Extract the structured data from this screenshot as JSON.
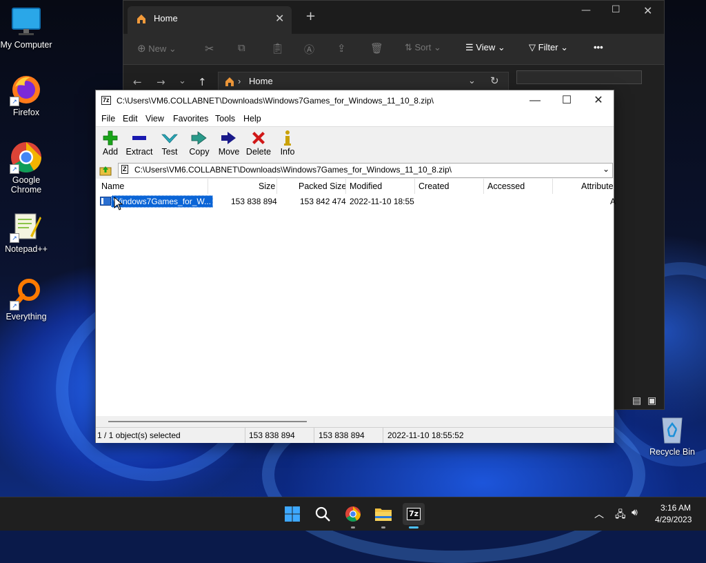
{
  "desktop": {
    "icons": [
      {
        "label": "My Computer"
      },
      {
        "label": "Firefox"
      },
      {
        "label": "Google Chrome"
      },
      {
        "label": "Notepad++"
      },
      {
        "label": "Everything"
      },
      {
        "label": "Recycle Bin"
      }
    ]
  },
  "explorer": {
    "tab_title": "Home",
    "new_tab": "+",
    "toolbar": {
      "new_label": "New",
      "sort_label": "Sort",
      "view_label": "View",
      "filter_label": "Filter",
      "more_label": "•••"
    },
    "address": "Home",
    "search_placeholder": ""
  },
  "zip": {
    "title": "C:\\Users\\VM6.COLLABNET\\Downloads\\Windows7Games_for_Windows_11_10_8.zip\\",
    "app_badge": "7z",
    "menu": [
      "File",
      "Edit",
      "View",
      "Favorites",
      "Tools",
      "Help"
    ],
    "toolbar": [
      {
        "label": "Add",
        "icon": "plus-icon",
        "color": "#1aa51a"
      },
      {
        "label": "Extract",
        "icon": "minus-icon",
        "color": "#1a1ab0"
      },
      {
        "label": "Test",
        "icon": "check-icon",
        "color": "#2aa7b5"
      },
      {
        "label": "Copy",
        "icon": "double-arrow-icon",
        "color": "#2a9a8a"
      },
      {
        "label": "Move",
        "icon": "arrow-right-icon",
        "color": "#1a1a8a"
      },
      {
        "label": "Delete",
        "icon": "x-icon",
        "color": "#d01818"
      },
      {
        "label": "Info",
        "icon": "info-icon",
        "color": "#caa20a"
      }
    ],
    "path": "C:\\Users\\VM6.COLLABNET\\Downloads\\Windows7Games_for_Windows_11_10_8.zip\\",
    "columns": [
      "Name",
      "Size",
      "Packed Size",
      "Modified",
      "Created",
      "Accessed",
      "Attribute"
    ],
    "rows": [
      {
        "name": "Windows7Games_for_W...",
        "size": "153 838 894",
        "packed": "153 842 474",
        "modified": "2022-11-10 18:55",
        "created": "",
        "accessed": "",
        "attr": "A"
      }
    ],
    "status": {
      "selection": "1 / 1 object(s) selected",
      "size": "153 838 894",
      "packed": "153 838 894",
      "modified": "2022-11-10 18:55:52"
    }
  },
  "taskbar": {
    "time": "3:16 AM",
    "date": "4/29/2023",
    "zip_badge": "7z"
  }
}
